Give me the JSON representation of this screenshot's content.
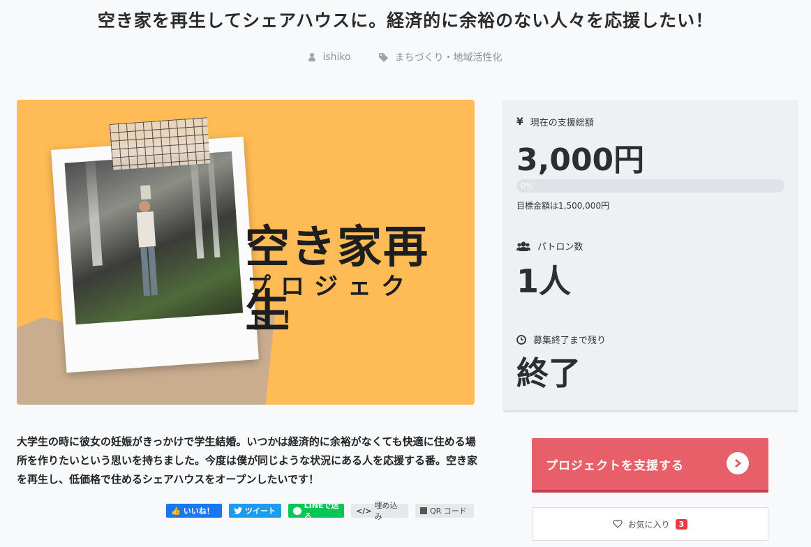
{
  "project": {
    "title": "空き家を再生してシェアハウスに。経済的に余裕のない人々を応援したい！",
    "author": "ishiko",
    "category": "まちづくり・地域活性化"
  },
  "hero": {
    "headline": "空き家再生",
    "subline": "プロジェクト！"
  },
  "description": "大学生の時に彼女の妊娠がきっかけで学生結婚。いつかは経済的に余裕がなくても快適に住める場所を作りたいという思いを持ちました。今度は僕が同じような状況にある人を応援する番。空き家を再生し、低価格で住めるシェアハウスをオープンしたいです！",
  "share": {
    "like": "いいね！",
    "tweet": "ツイート",
    "line": "LINEで送る",
    "embed": "埋め込み",
    "qr": "QR コード"
  },
  "stats": {
    "total_label": "現在の支援総額",
    "total_value": "3,000円",
    "progress_label": "0%",
    "progress_fraction": 0,
    "goal_text": "目標金額は1,500,000円",
    "patron_label": "パトロン数",
    "patron_value": "1人",
    "remaining_label": "募集終了まで残り",
    "remaining_value": "終了"
  },
  "actions": {
    "support_label": "プロジェクトを支援する",
    "favorite_label": "お気に入り",
    "favorite_count": "3"
  },
  "colors": {
    "hero_bg": "#ffbb55",
    "support_btn": "#e75f69",
    "badge": "#e83b43"
  }
}
